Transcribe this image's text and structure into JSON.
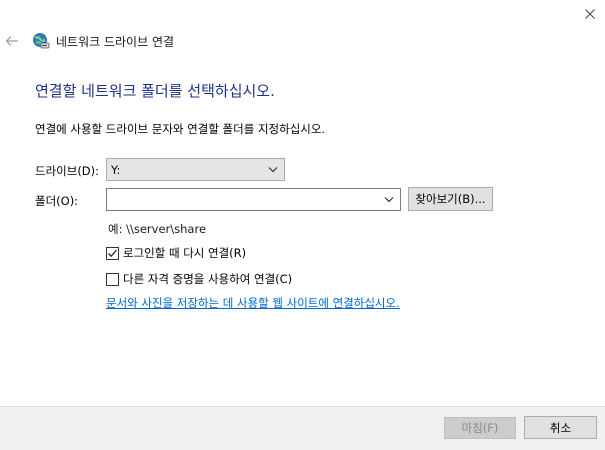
{
  "window": {
    "title": "네트워크 드라이브 연결",
    "close_label": "×",
    "back_label": "←"
  },
  "main": {
    "heading": "연결할 네트워크 폴더를 선택하십시오.",
    "instruction": "연결에 사용할 드라이브 문자와 연결할 폴더를 지정하십시오.",
    "drive_label": "드라이브(D):",
    "drive_value": "Y:",
    "folder_label": "폴더(O):",
    "folder_value": "",
    "browse_label": "찾아보기(B)...",
    "example_text": "예: \\\\server\\share",
    "reconnect_label": "로그인할 때 다시 연결(R)",
    "reconnect_checked": true,
    "credentials_label": "다른 자격 증명을 사용하여 연결(C)",
    "credentials_checked": false,
    "link_text": "문서와 사진을 저장하는 데 사용할 웹 사이트에 연결하십시오."
  },
  "footer": {
    "finish_label": "마침(F)",
    "cancel_label": "취소"
  },
  "colors": {
    "heading": "#1e3287",
    "link": "#0066cc",
    "footer_bg": "#f0f0f0"
  },
  "icons": {
    "title_icon": "network-drive-icon",
    "back": "back-arrow-icon",
    "close": "close-icon"
  }
}
